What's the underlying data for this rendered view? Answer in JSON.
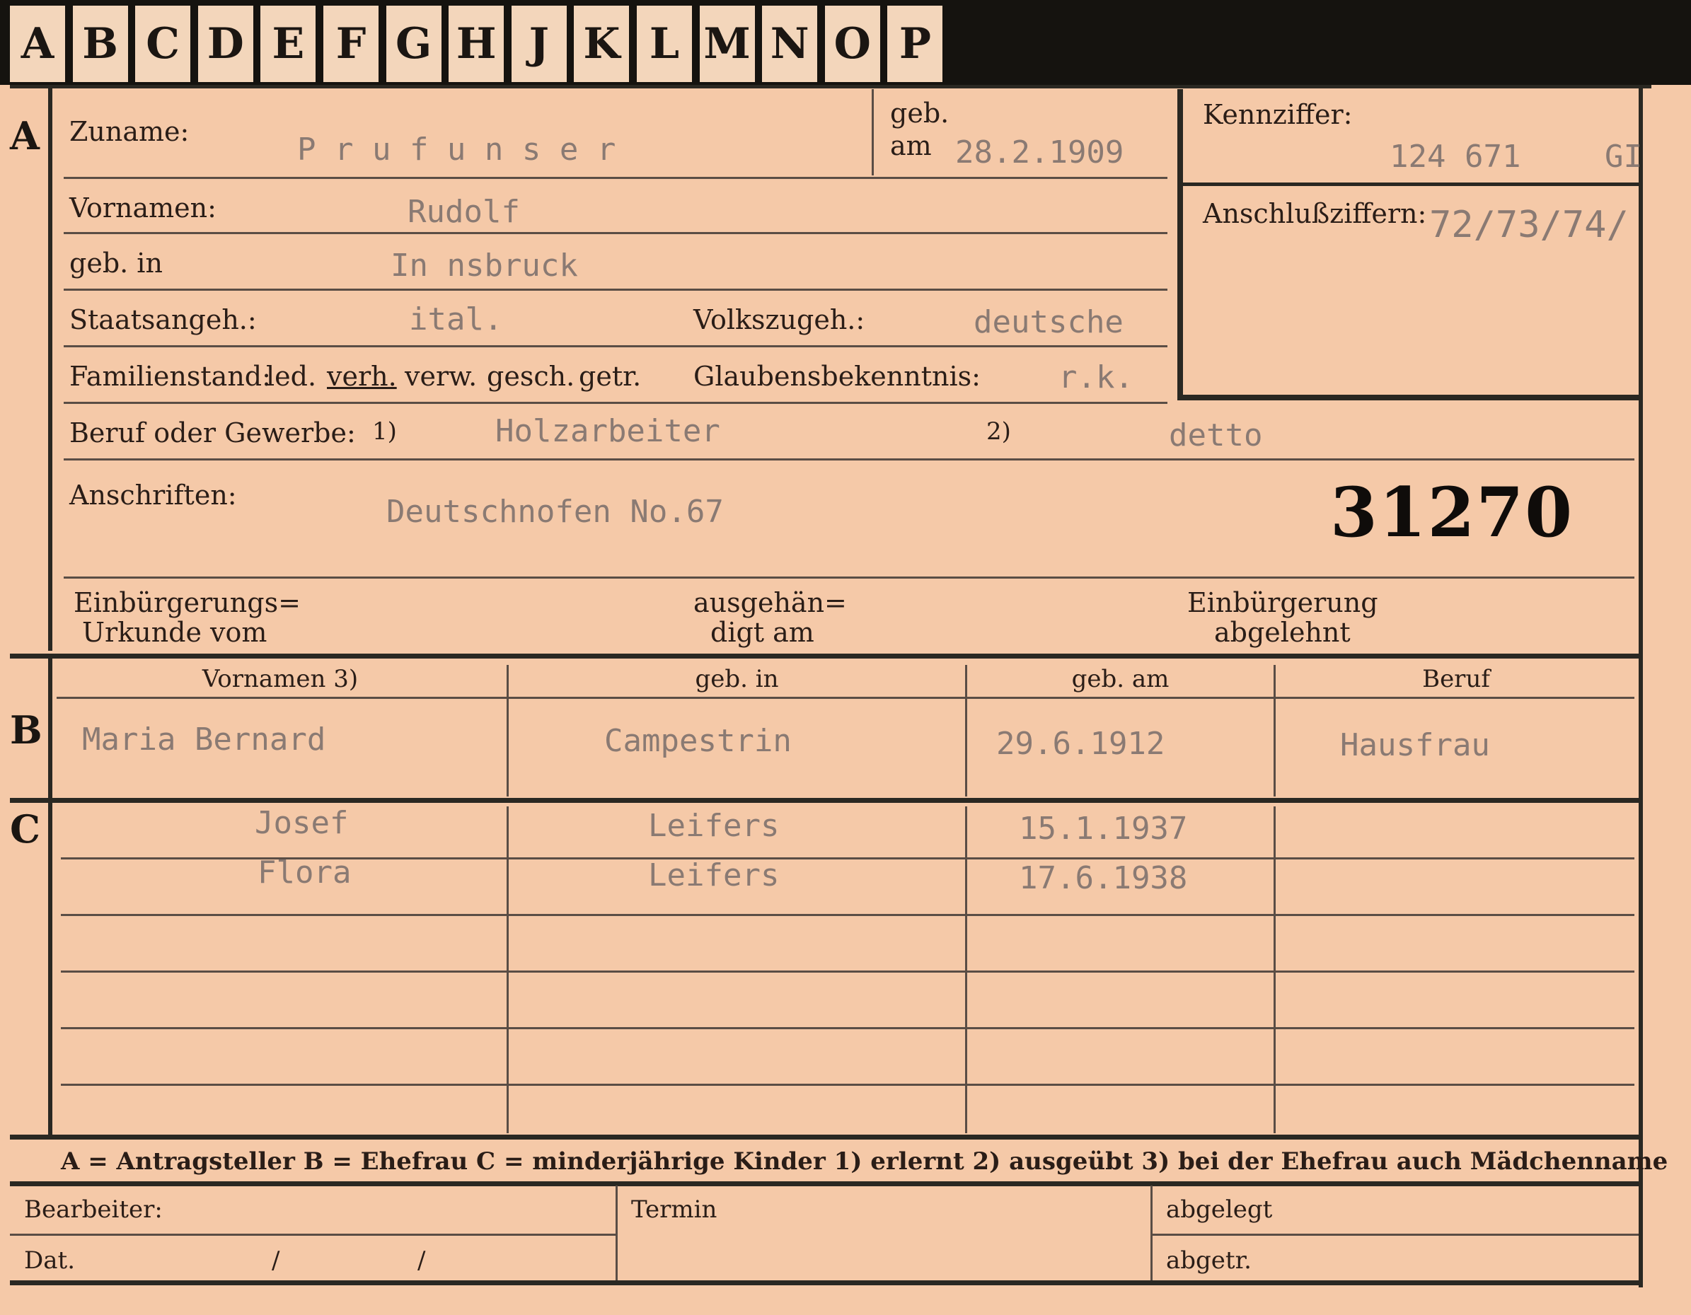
{
  "tabs": [
    "A",
    "B",
    "C",
    "D",
    "E",
    "F",
    "G",
    "H",
    "J",
    "K",
    "L",
    "M",
    "N",
    "O",
    "P"
  ],
  "sections": {
    "a": "A",
    "b": "B",
    "c": "C"
  },
  "applicant": {
    "surname_label": "Zuname:",
    "surname_value": "P r u f u n s  e r",
    "birth_date_label_1": "geb.",
    "birth_date_label_2": "am",
    "birth_date_value": "28.2.1909",
    "first_names_label": "Vornamen:",
    "first_names_value": "Rudolf",
    "birthplace_label": "geb. in",
    "birthplace_value": "In nsbruck",
    "citizenship_label": "Staatsangeh.:",
    "citizenship_value": "ital.",
    "ethnicity_label": "Volkszugeh.:",
    "ethnicity_value": "deutsche",
    "marital_label": "Familienstand:",
    "marital_options": [
      "led.",
      "verh.",
      "verw.",
      "gesch.",
      "getr."
    ],
    "religion_label": "Glaubensbekenntnis:",
    "religion_value": "r.k.",
    "occupation_label": "Beruf oder Gewerbe:",
    "occupation_mark_1": "1)",
    "occupation_value_1": "Holzarbeiter",
    "occupation_mark_2": "2)",
    "occupation_value_2": "detto",
    "addresses_label": "Anschriften:",
    "address_value": "Deutschnofen No.67",
    "serial_number": "31270",
    "naturalization_cert_label_1": "Einbürgerungs=",
    "naturalization_cert_label_2": "Urkunde vom",
    "delivered_label_1": "ausgehän=",
    "delivered_label_2": "digt am",
    "refused_label_1": "Einbürgerung",
    "refused_label_2": "abgelehnt"
  },
  "identifier": {
    "label": "Kennziffer:",
    "value": "124 671",
    "suffix": "GI",
    "connection_label": "Anschlußziffern:",
    "connection_value": "72/73/74/"
  },
  "columns": {
    "first_names": "Vornamen 3)",
    "birthplace": "geb. in",
    "birth_date": "geb. am",
    "occupation": "Beruf"
  },
  "spouse": {
    "first_names": "Maria Bernard",
    "birthplace": "Campestrin",
    "birth_date": "29.6.1912",
    "occupation": "Hausfrau"
  },
  "children": [
    {
      "first_names": "Josef",
      "birthplace": "Leifers",
      "birth_date": "15.1.1937",
      "occupation": ""
    },
    {
      "first_names": "Flora",
      "birthplace": "Leifers",
      "birth_date": "17.6.1938",
      "occupation": ""
    }
  ],
  "legend": "A = Antragsteller   B = Ehefrau   C = minderjährige Kinder   1) erlernt   2) ausgeübt   3) bei der Ehefrau auch Mädchenname",
  "footer": {
    "clerk_label": "Bearbeiter:",
    "date_label": "Dat.",
    "date_sep_1": "/",
    "date_sep_2": "/",
    "deadline_label": "Termin",
    "filed_label": "abgelegt",
    "delivered_label": "abgetr."
  }
}
